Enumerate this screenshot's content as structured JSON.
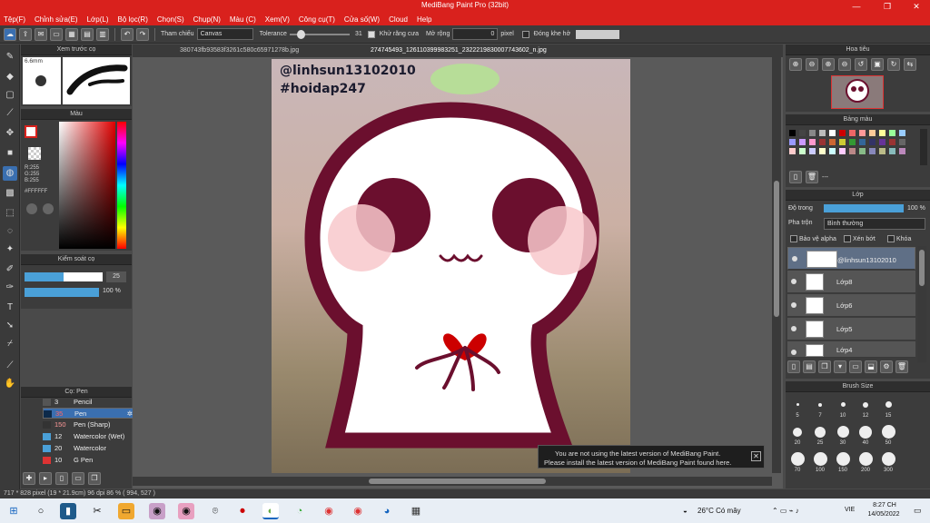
{
  "window": {
    "title": "MediBang Paint Pro (32bit)"
  },
  "menu": [
    "Tệp(F)",
    "Chỉnh sửa(E)",
    "Lớp(L)",
    "Bộ lọc(R)",
    "Chọn(S)",
    "Chụp(N)",
    "Màu (C)",
    "Xem(V)",
    "Công cụ(T)",
    "Cửa số(W)",
    "Cloud",
    "Help"
  ],
  "toolbar": {
    "reference_label": "Tham chiếu",
    "reference_value": "Canvas",
    "tolerance_label": "Tolerance",
    "tolerance_value": "31",
    "antialias_label": "Khử răng cưa",
    "expand_label": "Mở rộng",
    "expand_value": "0",
    "expand_unit": "pixel",
    "gap_label": "Đóng khe hở"
  },
  "tabs": [
    "380743fb93583f3261c580c65971278b.jpg",
    "274745493_126110399983251_2322219830007743602_n.jpg"
  ],
  "brush_preview": {
    "title": "Xem trước cọ",
    "size": "6.6mm"
  },
  "color_panel": {
    "title": "Màu",
    "r": "R:255",
    "g": "G:255",
    "b": "B:255",
    "hex": "#FFFFFF"
  },
  "brush_control": {
    "title": "Kiểm soát cọ",
    "size": "25",
    "opacity": "100 %"
  },
  "brush_list": {
    "title": "Cọ: Pen",
    "items": [
      {
        "num": "3",
        "name": "Pencil"
      },
      {
        "num": "35",
        "name": "Pen"
      },
      {
        "num": "150",
        "name": "Pen (Sharp)"
      },
      {
        "num": "12",
        "name": "Watercolor (Wet)"
      },
      {
        "num": "20",
        "name": "Watercolor"
      },
      {
        "num": "10",
        "name": "G Pen"
      }
    ]
  },
  "canvas_text": {
    "line1": "@linhsun13102010",
    "line2": "#hoidap247"
  },
  "navigator": {
    "title": "Hoa tiêu"
  },
  "palette": {
    "title": "Bảng màu",
    "empty": "---"
  },
  "layers": {
    "title": "Lớp",
    "opacity_label": "Độ trong",
    "opacity_value": "100 %",
    "blend_label": "Pha trộn",
    "blend_value": "Bình thường",
    "protect_alpha": "Bảo vệ alpha",
    "clipping": "Xén bớt",
    "lock": "Khóa",
    "items": [
      "@linhsun13102010",
      "Lớp8",
      "Lớp6",
      "Lớp5",
      "Lớp4"
    ]
  },
  "brush_size": {
    "title": "Brush Size",
    "sizes": [
      "5",
      "7",
      "10",
      "12",
      "15",
      "20",
      "25",
      "30",
      "40",
      "50",
      "70",
      "100",
      "150",
      "200",
      "300"
    ]
  },
  "notification": {
    "line1": "You are not using the latest version of MediBang Paint.",
    "line2": "Please install the latest version of MediBang Paint found here."
  },
  "status": {
    "text": "717 * 828 pixel   (19 * 21.9cm)   96 dpi   86 %   ( 994, 527 )"
  },
  "taskbar": {
    "weather": "26°C  Có mây",
    "lang": "VIE",
    "time": "8:27 CH",
    "date": "14/05/2022"
  }
}
